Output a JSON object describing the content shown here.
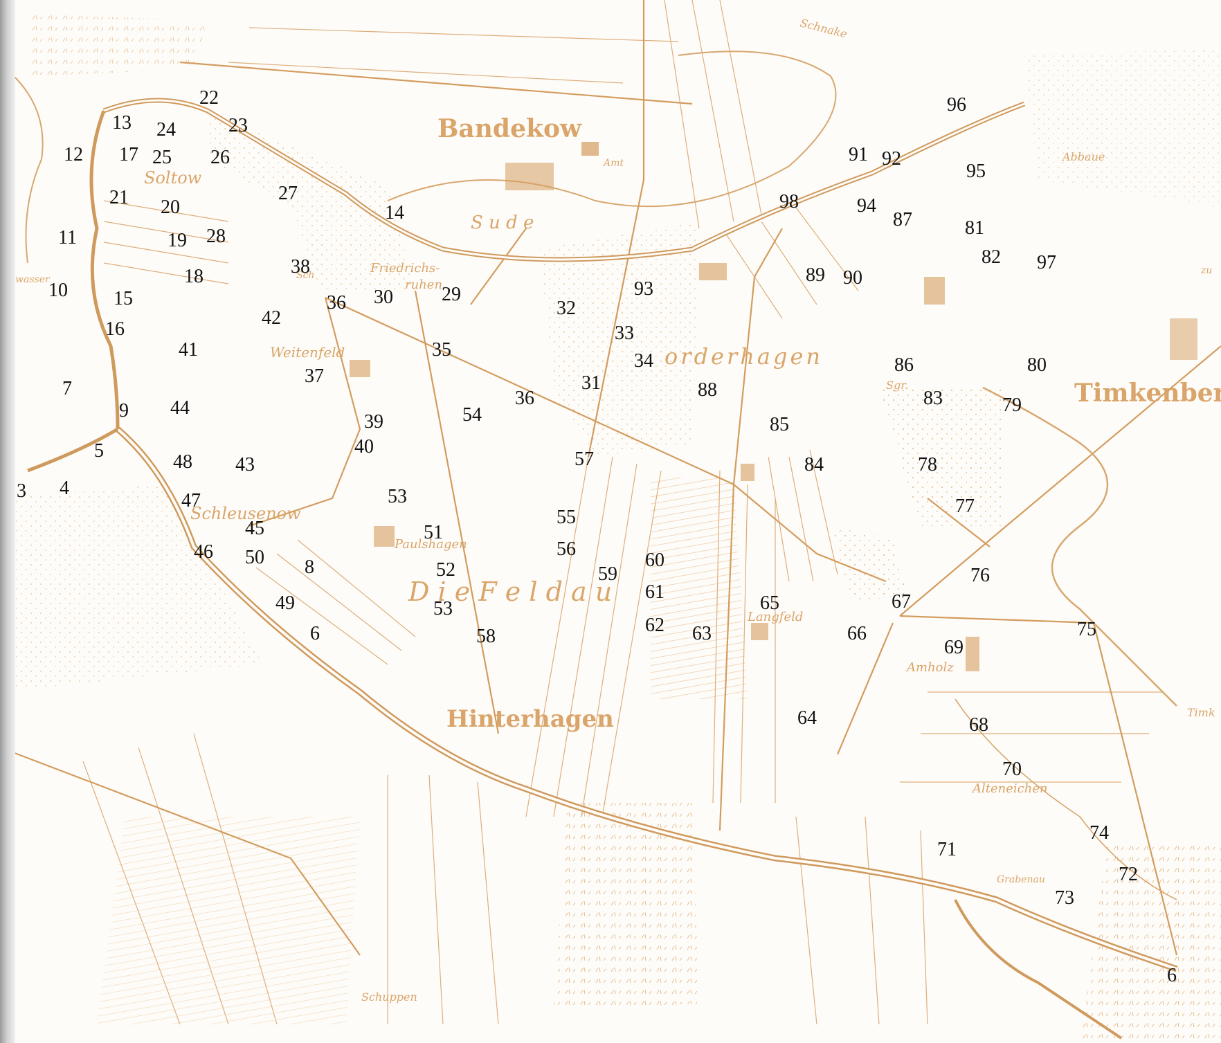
{
  "map": {
    "colors": {
      "ink": "#d9a56a",
      "river": "#cf9a5e",
      "paper": "#fefcf8",
      "numbers": "#111111"
    },
    "place_names": {
      "bandekow": "Bandekow",
      "sude": "S u d e",
      "soltow": "Soltow",
      "friedrichs": "Friedrichs-",
      "ruhen": "ruhen",
      "weitenfeld": "Weitenfeld",
      "vorderhagen": "orderhagen",
      "schleusenow": "Schleusenow",
      "paulshagen": "Paulshagen",
      "die_feldau": "D i e    F e l d a u",
      "langfeld": "Langfeld",
      "hinterhagen": "Hinterhagen",
      "amholz": "Amholz",
      "alteneichen": "Alteneichen",
      "timkenberg": "Timkenber",
      "timk": "Timk",
      "abbaue": "Abbaue",
      "sgr": "Sgr.",
      "sch": "Sch",
      "schnake": "Schnake",
      "grabenau": "Grabenau",
      "schuppen": "Schuppen",
      "zu": "zu",
      "amt": "Amt",
      "wasser": "wasser"
    },
    "markers": [
      "22",
      "13",
      "24",
      "23",
      "12",
      "17",
      "25",
      "26",
      "21",
      "20",
      "27",
      "14",
      "11",
      "19",
      "28",
      "18",
      "38",
      "10",
      "15",
      "36",
      "30",
      "29",
      "42",
      "16",
      "41",
      "35",
      "7",
      "37",
      "9",
      "44",
      "39",
      "5",
      "40",
      "48",
      "43",
      "4",
      "3",
      "47",
      "53",
      "45",
      "51",
      "46",
      "50",
      "8",
      "52",
      "49",
      "53",
      "6",
      "58",
      "32",
      "93",
      "33",
      "34",
      "31",
      "36",
      "54",
      "57",
      "55",
      "56",
      "59",
      "60",
      "61",
      "62",
      "63",
      "65",
      "88",
      "85",
      "84",
      "89",
      "90",
      "91",
      "92",
      "98",
      "94",
      "87",
      "96",
      "95",
      "81",
      "82",
      "97",
      "86",
      "83",
      "80",
      "79",
      "78",
      "77",
      "76",
      "67",
      "66",
      "69",
      "75",
      "64",
      "68",
      "70",
      "71",
      "74",
      "72",
      "73",
      "6"
    ]
  }
}
